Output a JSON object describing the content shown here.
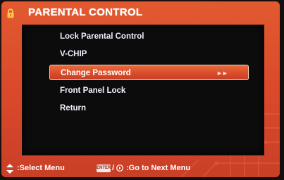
{
  "header": {
    "title": "PARENTAL CONTROL",
    "icon": "lock-icon"
  },
  "menu": {
    "items": [
      {
        "label": "Lock Parental Control",
        "selected": false
      },
      {
        "label": "V-CHIP",
        "selected": false
      },
      {
        "label": "Change Password",
        "selected": true,
        "indicator": "►►"
      },
      {
        "label": "Front Panel Lock",
        "selected": false
      },
      {
        "label": "Return",
        "selected": false
      }
    ]
  },
  "footer": {
    "select_text": ":Select Menu",
    "enter_key": "ENTER",
    "slash": "/",
    "next_text": ":Go to Next Menu"
  },
  "colors": {
    "frame_orange": "#d9482a",
    "panel_black": "#0c0c0c",
    "highlight": "#e2592f",
    "text": "#ffffff"
  }
}
